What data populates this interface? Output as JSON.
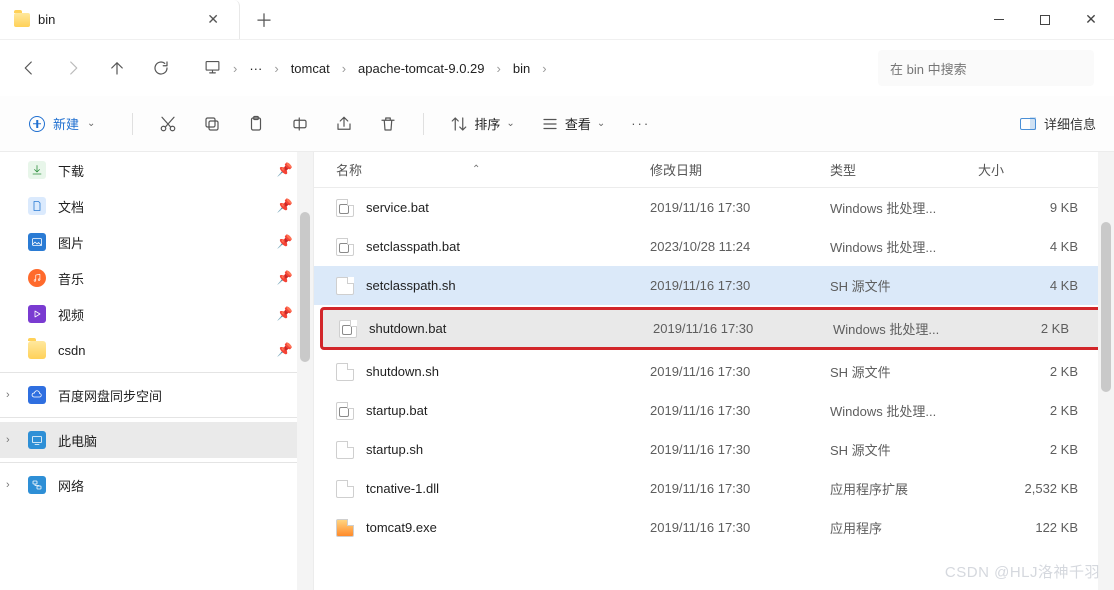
{
  "titlebar": {
    "tab_title": "bin"
  },
  "nav": {
    "breadcrumb": {
      "more": "···",
      "item1": "tomcat",
      "item2": "apache-tomcat-9.0.29",
      "item3": "bin"
    },
    "search_placeholder": "在 bin 中搜索"
  },
  "toolbar": {
    "new_label": "新建",
    "sort_label": "排序",
    "view_label": "查看",
    "details_label": "详细信息"
  },
  "sidebar": {
    "items": [
      {
        "label": "下载"
      },
      {
        "label": "文档"
      },
      {
        "label": "图片"
      },
      {
        "label": "音乐"
      },
      {
        "label": "视频"
      },
      {
        "label": "csdn"
      },
      {
        "label": "百度网盘同步空间"
      },
      {
        "label": "此电脑"
      },
      {
        "label": "网络"
      }
    ]
  },
  "columns": {
    "name": "名称",
    "date": "修改日期",
    "type": "类型",
    "size": "大小"
  },
  "files": [
    {
      "name": "service.bat",
      "date": "2019/11/16 17:30",
      "type": "Windows 批处理...",
      "size": "9 KB"
    },
    {
      "name": "setclasspath.bat",
      "date": "2023/10/28 11:24",
      "type": "Windows 批处理...",
      "size": "4 KB"
    },
    {
      "name": "setclasspath.sh",
      "date": "2019/11/16 17:30",
      "type": "SH 源文件",
      "size": "4 KB"
    },
    {
      "name": "shutdown.bat",
      "date": "2019/11/16 17:30",
      "type": "Windows 批处理...",
      "size": "2 KB"
    },
    {
      "name": "shutdown.sh",
      "date": "2019/11/16 17:30",
      "type": "SH 源文件",
      "size": "2 KB"
    },
    {
      "name": "startup.bat",
      "date": "2019/11/16 17:30",
      "type": "Windows 批处理...",
      "size": "2 KB"
    },
    {
      "name": "startup.sh",
      "date": "2019/11/16 17:30",
      "type": "SH 源文件",
      "size": "2 KB"
    },
    {
      "name": "tcnative-1.dll",
      "date": "2019/11/16 17:30",
      "type": "应用程序扩展",
      "size": "2,532 KB"
    },
    {
      "name": "tomcat9.exe",
      "date": "2019/11/16 17:30",
      "type": "应用程序",
      "size": "122 KB"
    }
  ],
  "watermark": "CSDN @HLJ洛神千羽"
}
